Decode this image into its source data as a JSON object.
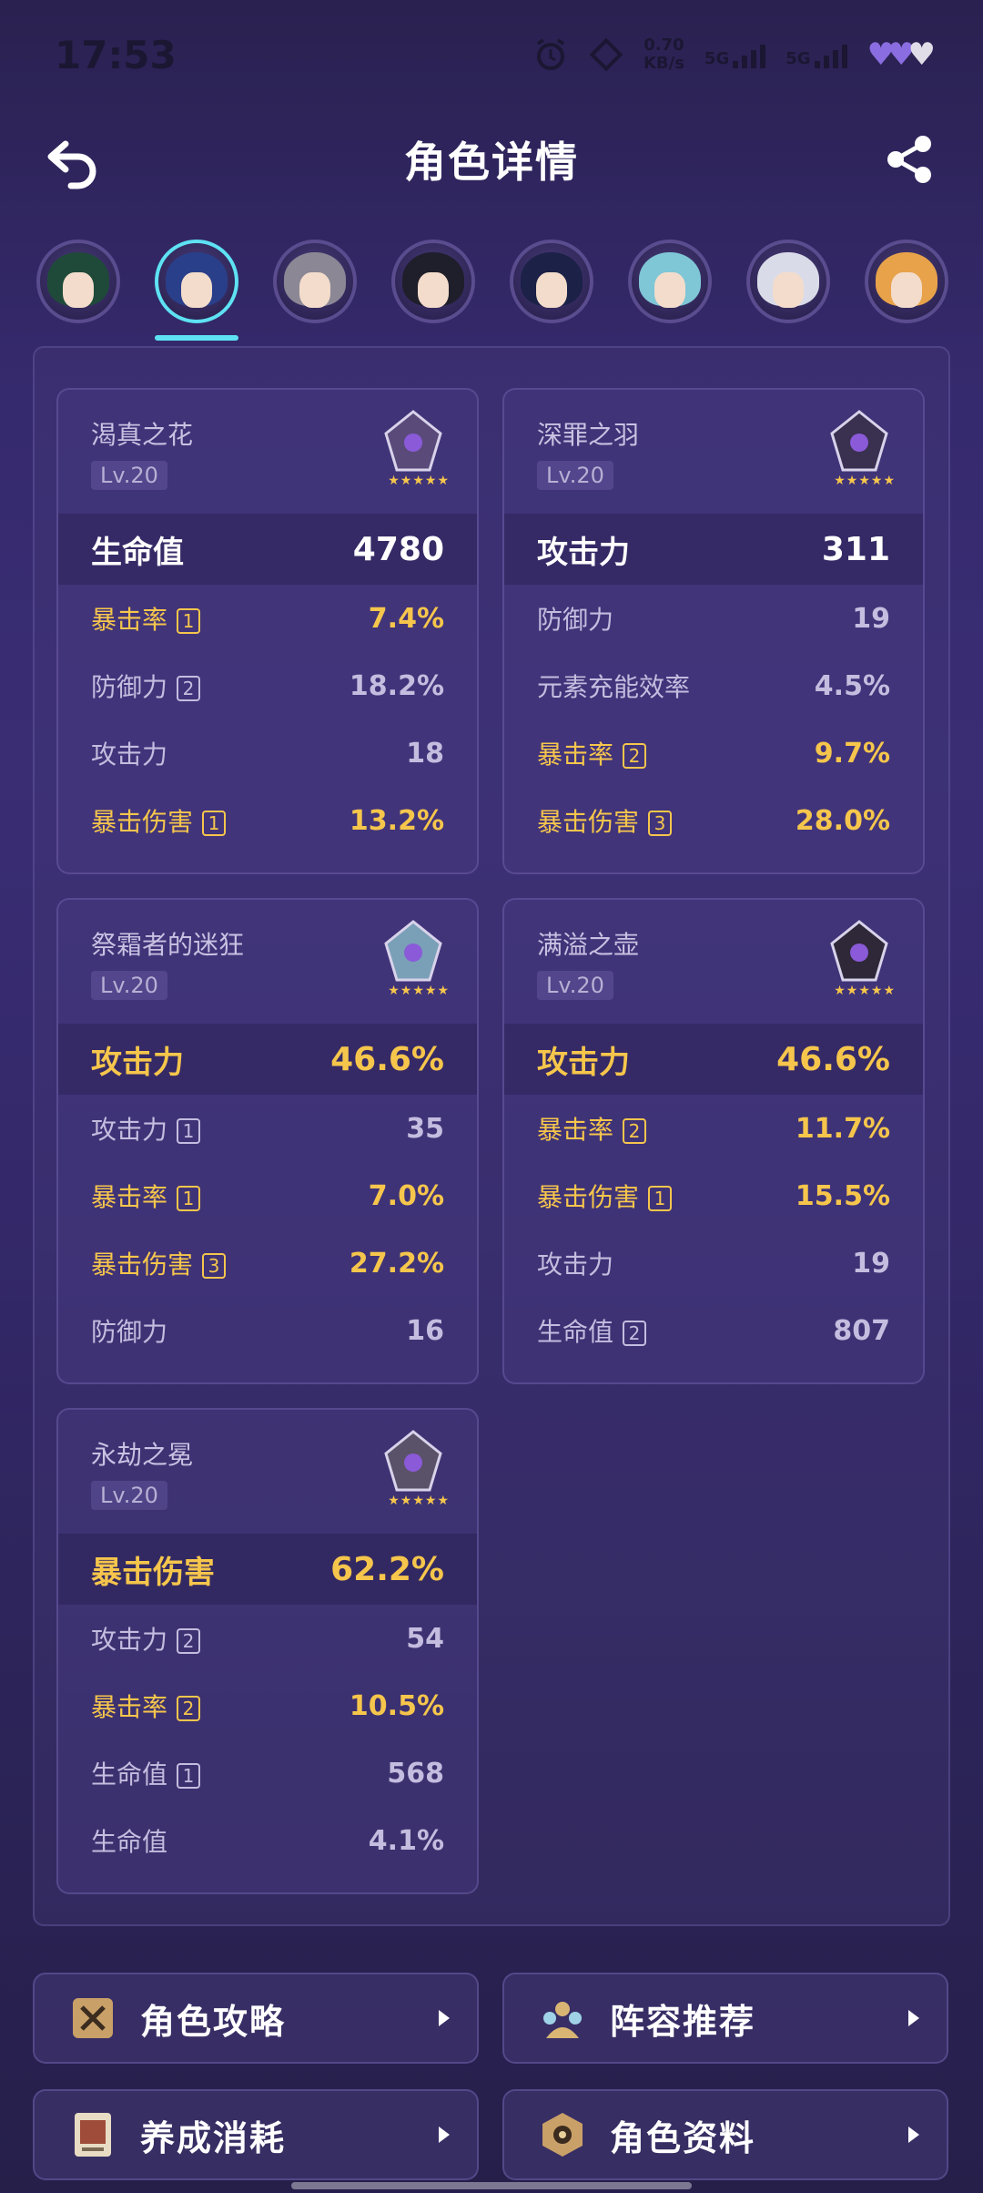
{
  "status": {
    "time": "17:53",
    "speed_value": "0.70",
    "speed_unit": "KB/s",
    "net1": "5G",
    "net2": "5G"
  },
  "header": {
    "title": "角色详情"
  },
  "avatars": [
    {
      "name": "avatar-1",
      "hair": "#1f4a3a",
      "active": false
    },
    {
      "name": "avatar-2",
      "hair": "#2a3f8a",
      "active": true
    },
    {
      "name": "avatar-3",
      "hair": "#8b8795",
      "active": false
    },
    {
      "name": "avatar-4",
      "hair": "#1f1e2b",
      "active": false
    },
    {
      "name": "avatar-5",
      "hair": "#1b2147",
      "active": false
    },
    {
      "name": "avatar-6",
      "hair": "#7fc6d6",
      "active": false
    },
    {
      "name": "avatar-7",
      "hair": "#d9dbe8",
      "active": false
    },
    {
      "name": "avatar-8",
      "hair": "#e7a24a",
      "active": false
    }
  ],
  "artifacts": [
    {
      "name": "渴真之花",
      "level": "Lv.20",
      "stars": "★★★★★",
      "main": {
        "label": "生命值",
        "value": "4780",
        "gold": false
      },
      "subs": [
        {
          "label": "暴击率",
          "badge": "1",
          "value": "7.4%",
          "gold": true
        },
        {
          "label": "防御力",
          "badge": "2",
          "value": "18.2%",
          "gold": false
        },
        {
          "label": "攻击力",
          "badge": "",
          "value": "18",
          "gold": false
        },
        {
          "label": "暴击伤害",
          "badge": "1",
          "value": "13.2%",
          "gold": true
        }
      ]
    },
    {
      "name": "深罪之羽",
      "level": "Lv.20",
      "stars": "★★★★★",
      "main": {
        "label": "攻击力",
        "value": "311",
        "gold": false
      },
      "subs": [
        {
          "label": "防御力",
          "badge": "",
          "value": "19",
          "gold": false
        },
        {
          "label": "元素充能效率",
          "badge": "",
          "value": "4.5%",
          "gold": false
        },
        {
          "label": "暴击率",
          "badge": "2",
          "value": "9.7%",
          "gold": true
        },
        {
          "label": "暴击伤害",
          "badge": "3",
          "value": "28.0%",
          "gold": true
        }
      ]
    },
    {
      "name": "祭霜者的迷狂",
      "level": "Lv.20",
      "stars": "★★★★★",
      "main": {
        "label": "攻击力",
        "value": "46.6%",
        "gold": true
      },
      "subs": [
        {
          "label": "攻击力",
          "badge": "1",
          "value": "35",
          "gold": false
        },
        {
          "label": "暴击率",
          "badge": "1",
          "value": "7.0%",
          "gold": true
        },
        {
          "label": "暴击伤害",
          "badge": "3",
          "value": "27.2%",
          "gold": true
        },
        {
          "label": "防御力",
          "badge": "",
          "value": "16",
          "gold": false
        }
      ]
    },
    {
      "name": "满溢之壶",
      "level": "Lv.20",
      "stars": "★★★★★",
      "main": {
        "label": "攻击力",
        "value": "46.6%",
        "gold": true
      },
      "subs": [
        {
          "label": "暴击率",
          "badge": "2",
          "value": "11.7%",
          "gold": true
        },
        {
          "label": "暴击伤害",
          "badge": "1",
          "value": "15.5%",
          "gold": true
        },
        {
          "label": "攻击力",
          "badge": "",
          "value": "19",
          "gold": false
        },
        {
          "label": "生命值",
          "badge": "2",
          "value": "807",
          "gold": false
        }
      ]
    },
    {
      "name": "永劫之冕",
      "level": "Lv.20",
      "stars": "★★★★★",
      "main": {
        "label": "暴击伤害",
        "value": "62.2%",
        "gold": true
      },
      "subs": [
        {
          "label": "攻击力",
          "badge": "2",
          "value": "54",
          "gold": false
        },
        {
          "label": "暴击率",
          "badge": "2",
          "value": "10.5%",
          "gold": true
        },
        {
          "label": "生命值",
          "badge": "1",
          "value": "568",
          "gold": false
        },
        {
          "label": "生命值",
          "badge": "",
          "value": "4.1%",
          "gold": false
        }
      ]
    }
  ],
  "buttons": [
    {
      "label": "角色攻略",
      "icon": "guide-icon"
    },
    {
      "label": "阵容推荐",
      "icon": "team-icon"
    },
    {
      "label": "养成消耗",
      "icon": "materials-icon"
    },
    {
      "label": "角色资料",
      "icon": "profile-icon"
    }
  ],
  "colors": {
    "accent": "#5ee2f3",
    "gold": "#f6c64c"
  }
}
